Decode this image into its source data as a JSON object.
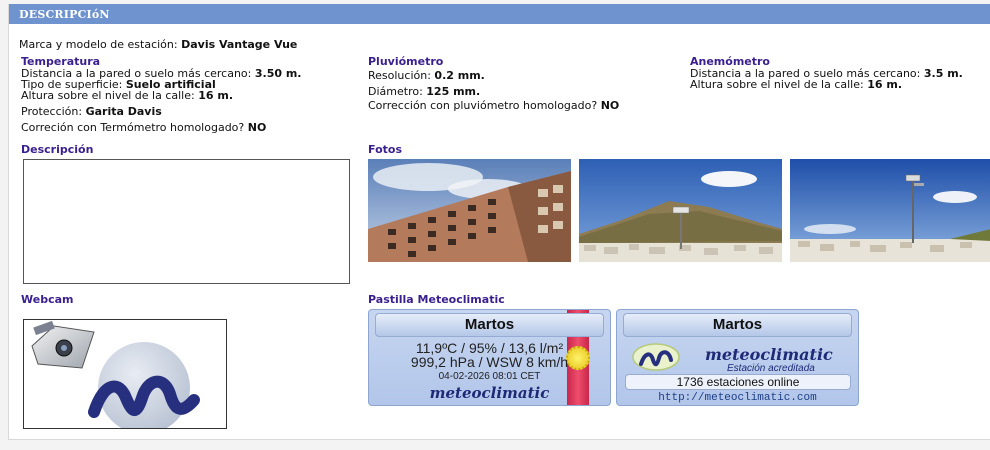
{
  "header": {
    "title": "DESCRIPCIóN"
  },
  "station": {
    "label": "Marca y modelo de estación:",
    "value": "Davis Vantage Vue"
  },
  "temperatura": {
    "heading": "Temperatura",
    "distance_label": "Distancia a la pared o suelo más cercano:",
    "distance_value": "3.50 m.",
    "surface_label": "Tipo de superficie:",
    "surface_value": "Suelo artificial",
    "height_label": "Altura sobre el nivel de la calle:",
    "height_value": "16 m.",
    "protection_label": "Protección:",
    "protection_value": "Garita Davis",
    "correction_label": "Correción con Termómetro homologado?",
    "correction_value": "NO"
  },
  "pluviometro": {
    "heading": "Pluviómetro",
    "resolution_label": "Resolución:",
    "resolution_value": "0.2 mm.",
    "diameter_label": "Diámetro:",
    "diameter_value": "125 mm.",
    "correction_label": "Corrección con pluviómetro homologado?",
    "correction_value": "NO"
  },
  "anemometro": {
    "heading": "Anemómetro",
    "distance_label": "Distancia a la pared o suelo más cercano:",
    "distance_value": "3.5 m.",
    "height_label": "Altura sobre el nivel de la calle:",
    "height_value": "16 m."
  },
  "descripcion": {
    "heading": "Descripción"
  },
  "fotos": {
    "heading": "Fotos"
  },
  "webcam": {
    "heading": "Webcam"
  },
  "pastilla": {
    "heading": "Pastilla Meteoclimatic",
    "badge1": {
      "title": "Martos",
      "line1": "11,9ºC / 95% / 13,6 l/m²",
      "line2": "999,2 hPa / WSW 8 km/h",
      "timestamp": "04-02-2026 08:01 CET",
      "brand": "meteoclimatic"
    },
    "badge2": {
      "title": "Martos",
      "brand": "meteoclimatic",
      "subtitle": "Estación acreditada",
      "online": "1736 estaciones online",
      "url": "http://meteoclimatic.com"
    }
  },
  "colors": {
    "header_bar": "#6e93cf",
    "heading": "#3a1f8e",
    "badge_bg": "#b9cbec"
  }
}
